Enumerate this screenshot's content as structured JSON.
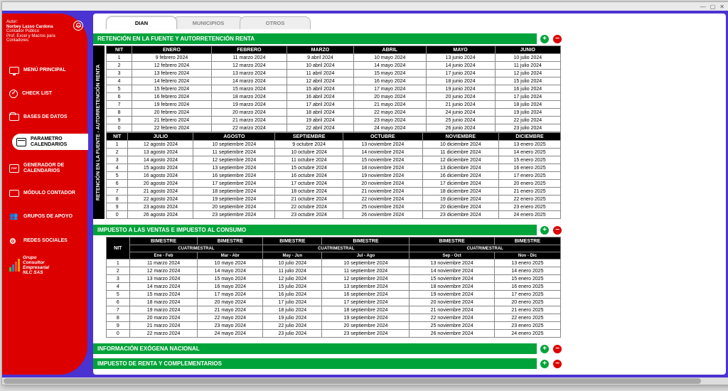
{
  "window": {
    "minimize": "—",
    "maximize": "▢",
    "close": "✕"
  },
  "author": {
    "label": "Autor:",
    "name": "Norbey Lasso Cardona",
    "role1": "Contador Público",
    "role2": "Prof. Excel y Macros para Contadores"
  },
  "nav": [
    {
      "key": "menu",
      "label": "MENÚ PRINCIPAL",
      "icon": "icon-monitor"
    },
    {
      "key": "checklist",
      "label": "CHECK LIST",
      "icon": "icon-check-circle"
    },
    {
      "key": "bases",
      "label": "BASES DE DATOS",
      "icon": "icon-folder"
    },
    {
      "key": "param",
      "label": "PARAMETRO CALENDARIOS",
      "icon": "icon-calendar",
      "active": true
    },
    {
      "key": "gen",
      "label": "GENERADOR DE CALENDARIOS",
      "icon": "icon-pdf"
    },
    {
      "key": "mod",
      "label": "MÓDULO CONTADOR",
      "icon": "icon-wallet"
    },
    {
      "key": "grupos",
      "label": "GRUPOS DE APOYO",
      "icon": "icon-group",
      "glyph": "👥"
    },
    {
      "key": "redes",
      "label": "REDES SOCIALES",
      "icon": "icon-gear",
      "glyph": "⚙"
    }
  ],
  "group": {
    "l1": "Grupo",
    "l2": "Consultor",
    "l3": "Empresarial",
    "l4": "NLC SAS"
  },
  "tabs": [
    {
      "label": "DIAN",
      "active": true
    },
    {
      "label": "MUNICIPIOS"
    },
    {
      "label": "OTROS"
    }
  ],
  "sections": {
    "retencion": {
      "title": "RETENCIÓN EN LA FUENTE Y AUTORRETENCIÓN RENTA",
      "side_label": "RETENCIÓN EN LA FUENTE - AUTORRETENCIÓN RENTA",
      "nit_label": "NIT",
      "months1": [
        "ENERO",
        "FEBRERO",
        "MARZO",
        "ABRIL",
        "MAYO",
        "JUNIO"
      ],
      "months2": [
        "JULIO",
        "AGOSTO",
        "SEPTIEMBRE",
        "OCTUBRE",
        "NOVIEMBRE",
        "DICIEMBRE"
      ],
      "rows1": [
        {
          "n": "1",
          "c": [
            "9 febrero 2024",
            "11 marzo 2024",
            "9 abril 2024",
            "10 mayo 2024",
            "13 junio 2024",
            "10 julio 2024"
          ]
        },
        {
          "n": "2",
          "c": [
            "12 febrero 2024",
            "12 marzo 2024",
            "10 abril 2024",
            "14 mayo 2024",
            "14 junio 2024",
            "11 julio 2024"
          ]
        },
        {
          "n": "3",
          "c": [
            "13 febrero 2024",
            "13 marzo 2024",
            "11 abril 2024",
            "15 mayo 2024",
            "17 junio 2024",
            "12 julio 2024"
          ]
        },
        {
          "n": "4",
          "c": [
            "14 febrero 2024",
            "14 marzo 2024",
            "12 abril 2024",
            "16 mayo 2024",
            "18 junio 2024",
            "15 julio 2024"
          ]
        },
        {
          "n": "5",
          "c": [
            "15 febrero 2024",
            "15 marzo 2024",
            "15 abril 2024",
            "17 mayo 2024",
            "19 junio 2024",
            "16 julio 2024"
          ]
        },
        {
          "n": "6",
          "c": [
            "16 febrero 2024",
            "18 marzo 2024",
            "16 abril 2024",
            "20 mayo 2024",
            "20 junio 2024",
            "17 julio 2024"
          ]
        },
        {
          "n": "7",
          "c": [
            "19 febrero 2024",
            "19 marzo 2024",
            "17 abril 2024",
            "21 mayo 2024",
            "21 junio 2024",
            "18 julio 2024"
          ]
        },
        {
          "n": "8",
          "c": [
            "20 febrero 2024",
            "20 marzo 2024",
            "18 abril 2024",
            "22 mayo 2024",
            "24 junio 2024",
            "19 julio 2024"
          ]
        },
        {
          "n": "9",
          "c": [
            "21 febrero 2024",
            "21 marzo 2024",
            "19 abril 2024",
            "23 mayo 2024",
            "25 junio 2024",
            "22 julio 2024"
          ]
        },
        {
          "n": "0",
          "c": [
            "22 febrero 2024",
            "22 marzo 2024",
            "22 abril 2024",
            "24 mayo 2024",
            "26 junio 2024",
            "23 julio 2024"
          ]
        }
      ],
      "rows2": [
        {
          "n": "1",
          "c": [
            "12 agosto 2024",
            "10 septiembre 2024",
            "9 octubre 2024",
            "13 noviembre 2024",
            "10 diciembre 2024",
            "13 enero 2025"
          ]
        },
        {
          "n": "2",
          "c": [
            "13 agosto 2024",
            "11 septiembre 2024",
            "10 octubre 2024",
            "14 noviembre 2024",
            "11 diciembre 2024",
            "14 enero 2025"
          ]
        },
        {
          "n": "3",
          "c": [
            "14 agosto 2024",
            "12 septiembre 2024",
            "11 octubre 2024",
            "15 noviembre 2024",
            "12 diciembre 2024",
            "15 enero 2025"
          ]
        },
        {
          "n": "4",
          "c": [
            "15 agosto 2024",
            "13 septiembre 2024",
            "15 octubre 2024",
            "18 noviembre 2024",
            "13 diciembre 2024",
            "16 enero 2025"
          ]
        },
        {
          "n": "5",
          "c": [
            "16 agosto 2024",
            "16 septiembre 2024",
            "16 octubre 2024",
            "19 noviembre 2024",
            "16 diciembre 2024",
            "17 enero 2025"
          ]
        },
        {
          "n": "6",
          "c": [
            "20 agosto 2024",
            "17 septiembre 2024",
            "17 octubre 2024",
            "20 noviembre 2024",
            "17 diciembre 2024",
            "20 enero 2025"
          ]
        },
        {
          "n": "7",
          "c": [
            "21 agosto 2024",
            "18 septiembre 2024",
            "18 octubre 2024",
            "21 noviembre 2024",
            "18 diciembre 2024",
            "21 enero 2025"
          ]
        },
        {
          "n": "8",
          "c": [
            "22 agosto 2024",
            "19 septiembre 2024",
            "21 octubre 2024",
            "22 noviembre 2024",
            "19 diciembre 2024",
            "22 enero 2025"
          ]
        },
        {
          "n": "9",
          "c": [
            "23 agosto 2024",
            "20 septiembre 2024",
            "22 octubre 2024",
            "25 noviembre 2024",
            "20 diciembre 2024",
            "23 enero 2025"
          ]
        },
        {
          "n": "0",
          "c": [
            "26 agosto 2024",
            "23 septiembre 2024",
            "23 octubre 2024",
            "26 noviembre 2024",
            "23 diciembre 2024",
            "24 enero 2025"
          ]
        }
      ]
    },
    "iva": {
      "title": "IMPUESTO A LAS VENTAS E IMPUESTO AL CONSUMO",
      "nit_label": "NIT",
      "top_header": "BIMESTRE",
      "mid_header": "CUATRIMESTRAL",
      "periods": [
        "Ene - Feb",
        "Mar - Abr",
        "May - Jun",
        "Jul - Ago",
        "Sep - Oct",
        "Nov - Dic"
      ],
      "rows": [
        {
          "n": "1",
          "c": [
            "11 marzo 2024",
            "10 mayo 2024",
            "10 julio 2024",
            "10 septiembre 2024",
            "13 noviembre 2024",
            "13 enero 2025"
          ]
        },
        {
          "n": "2",
          "c": [
            "12 marzo 2024",
            "14 mayo 2024",
            "11 julio 2024",
            "11 septiembre 2024",
            "14 noviembre 2024",
            "14 enero 2025"
          ]
        },
        {
          "n": "3",
          "c": [
            "13 marzo 2024",
            "15 mayo 2024",
            "12 julio 2024",
            "12 septiembre 2024",
            "15 noviembre 2024",
            "15 enero 2025"
          ]
        },
        {
          "n": "4",
          "c": [
            "14 marzo 2024",
            "16 mayo 2024",
            "15 julio 2024",
            "13 septiembre 2024",
            "18 noviembre 2024",
            "16 enero 2025"
          ]
        },
        {
          "n": "5",
          "c": [
            "15 marzo 2024",
            "17 mayo 2024",
            "16 julio 2024",
            "16 septiembre 2024",
            "19 noviembre 2024",
            "17 enero 2025"
          ]
        },
        {
          "n": "6",
          "c": [
            "18 marzo 2024",
            "20 mayo 2024",
            "17 julio 2024",
            "17 septiembre 2024",
            "20 noviembre 2024",
            "20 enero 2025"
          ]
        },
        {
          "n": "7",
          "c": [
            "19 marzo 2024",
            "21 mayo 2024",
            "18 julio 2024",
            "18 septiembre 2024",
            "21 noviembre 2024",
            "21 enero 2025"
          ]
        },
        {
          "n": "8",
          "c": [
            "20 marzo 2024",
            "22 mayo 2024",
            "19 julio 2024",
            "19 septiembre 2024",
            "22 noviembre 2024",
            "22 enero 2025"
          ]
        },
        {
          "n": "9",
          "c": [
            "21 marzo 2024",
            "23 mayo 2024",
            "22 julio 2024",
            "20 septiembre 2024",
            "25 noviembre 2024",
            "23 enero 2025"
          ]
        },
        {
          "n": "0",
          "c": [
            "22 marzo 2024",
            "24 mayo 2024",
            "23 julio 2024",
            "23 septiembre 2024",
            "26 noviembre 2024",
            "24 enero 2025"
          ]
        }
      ]
    },
    "exogena": {
      "title": "INFORMACIÓN EXÓGENA NACIONAL"
    },
    "renta": {
      "title": "IMPUESTO DE RENTA Y COMPLEMENTARIOS"
    }
  },
  "ctrl": {
    "add": "+",
    "remove": "−"
  }
}
